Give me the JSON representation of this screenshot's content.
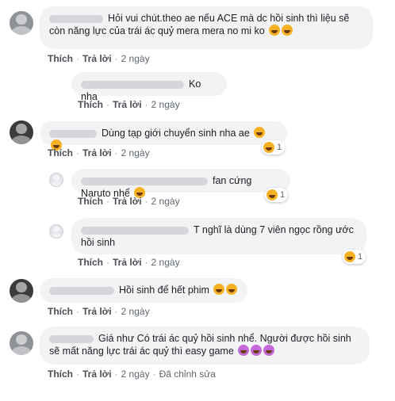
{
  "comments": [
    {
      "text": "Hỏi vui chút.theo ae nếu ACE mà dc hồi sinh thì liệu sẽ còn năng lực của trái ác quỷ mera mera no mi ko",
      "actions": {
        "like": "Thích",
        "reply": "Trả lời",
        "time": "2 ngày"
      }
    },
    {
      "text": "Ko nha",
      "actions": {
        "like": "Thích",
        "reply": "Trả lời",
        "time": "2 ngày"
      }
    },
    {
      "text": "Dùng tạp giới chuyển sinh nha ae",
      "reaction_count": "1",
      "actions": {
        "like": "Thích",
        "reply": "Trả lời",
        "time": "2 ngày"
      }
    },
    {
      "text": "fan cứng Naruto nhể",
      "reaction_count": "1",
      "actions": {
        "like": "Thích",
        "reply": "Trả lời",
        "time": "2 ngày"
      }
    },
    {
      "text": "T nghĩ là dùng 7 viên ngọc rồng ước hồi sinh",
      "reaction_count": "1",
      "actions": {
        "like": "Thích",
        "reply": "Trả lời",
        "time": "2 ngày"
      }
    },
    {
      "text": "Hồi sinh để hết phim",
      "actions": {
        "like": "Thích",
        "reply": "Trả lời",
        "time": "2 ngày"
      }
    },
    {
      "text": "Giá như Có trái ác quỷ hồi sinh nhể. Người được hồi sinh sẽ mất năng lực trái ác quỷ thì easy game",
      "actions": {
        "like": "Thích",
        "reply": "Trả lời",
        "time": "2 ngày",
        "edited": "Đã chỉnh sửa"
      }
    }
  ]
}
